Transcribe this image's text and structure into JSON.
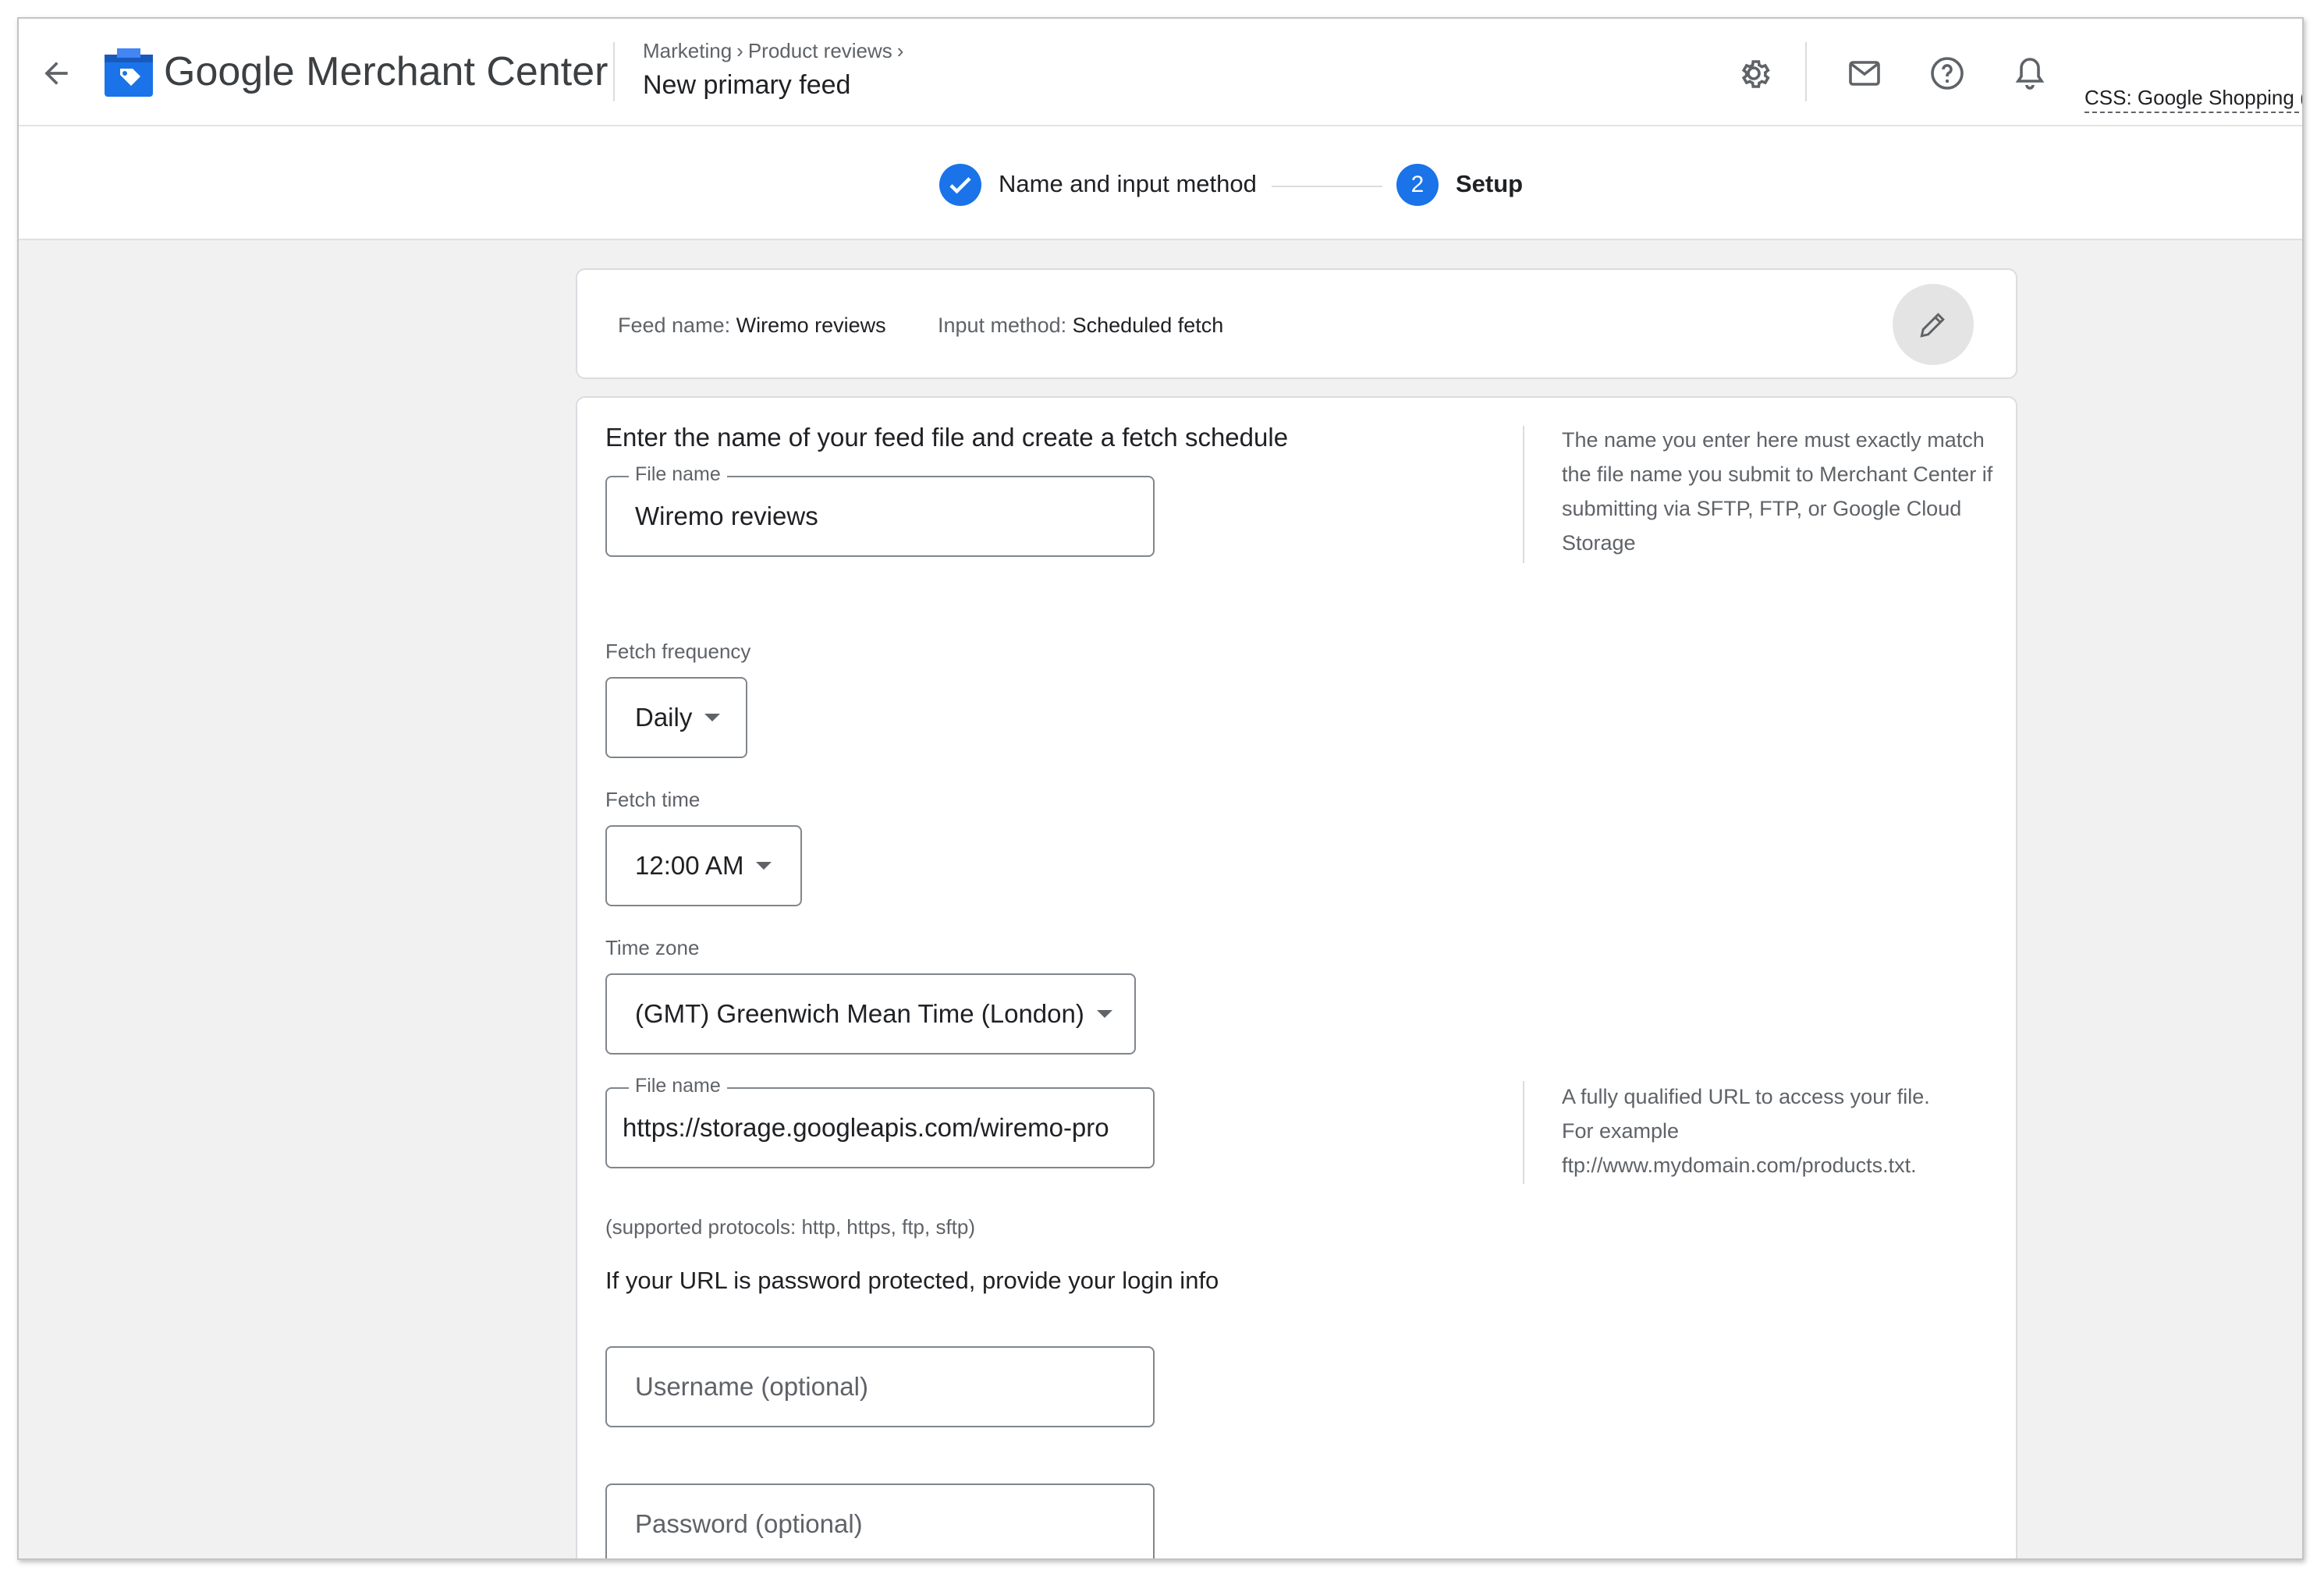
{
  "header": {
    "logo_google": "Google",
    "logo_product": "Merchant Center",
    "breadcrumbs": [
      "Marketing",
      "Product reviews"
    ],
    "page_title": "New primary feed",
    "account": "CSS: Google Shopping ("
  },
  "icons": {
    "back": "arrow-left-icon",
    "logo": "merchant-center-logo-icon",
    "settings": "gear-icon",
    "mail": "mail-icon",
    "help": "help-icon",
    "notifications": "bell-icon",
    "edit": "pencil-icon"
  },
  "colors": {
    "accent": "#1a73e8",
    "background": "#f1f1f1"
  },
  "stepper": {
    "step1": {
      "label": "Name and input method",
      "state": "completed"
    },
    "step2": {
      "number": "2",
      "label": "Setup",
      "state": "active"
    }
  },
  "summary": {
    "feed_name_key": "Feed name:",
    "feed_name_value": "Wiremo reviews",
    "input_method_key": "Input method:",
    "input_method_value": "Scheduled fetch"
  },
  "form": {
    "title": "Enter the name of your feed file and create a fetch schedule",
    "file_name_label": "File name",
    "file_name_value": "Wiremo reviews",
    "file_name_hint": "The name you enter here must exactly match the file name you submit to Merchant Center if submitting via SFTP, FTP, or Google Cloud Storage",
    "fetch_frequency_label": "Fetch frequency",
    "fetch_frequency_value": "Daily",
    "fetch_time_label": "Fetch time",
    "fetch_time_value": "12:00 AM",
    "time_zone_label": "Time zone",
    "time_zone_value": "(GMT) Greenwich Mean Time (London)",
    "url_label": "File name",
    "url_value": "https://storage.googleapis.com/wiremo-pro",
    "url_hint_line1": "A fully qualified URL to access your file.",
    "url_hint_line2": "For example",
    "url_hint_line3": "ftp://www.mydomain.com/products.txt.",
    "protocols_note": "(supported protocols: http, https, ftp, sftp)",
    "login_prompt": "If your URL is password protected, provide your login info",
    "username_placeholder": "Username (optional)",
    "password_placeholder": "Password (optional)"
  }
}
